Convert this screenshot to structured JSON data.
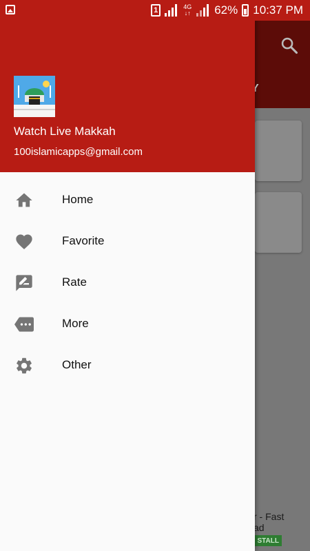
{
  "status_bar": {
    "sim_slot": "1",
    "network": "4G",
    "battery": "62%",
    "time": "10:37 PM"
  },
  "drawer": {
    "app_name": "Watch Live Makkah",
    "email": "100islamicapps@gmail.com",
    "items": [
      {
        "label": "Home",
        "icon": "home-icon"
      },
      {
        "label": "Favorite",
        "icon": "heart-icon"
      },
      {
        "label": "Rate",
        "icon": "rate-review-icon"
      },
      {
        "label": "More",
        "icon": "more-tag-icon"
      },
      {
        "label": "Other",
        "icon": "gear-icon"
      }
    ]
  },
  "background": {
    "tab_fragment": "Y",
    "ad_text_line1": "r - Fast",
    "ad_text_line2": "ad",
    "ad_button": "STALL"
  },
  "colors": {
    "primary": "#b71c14",
    "icon": "#757575",
    "drawer_bg": "#fafafa"
  }
}
